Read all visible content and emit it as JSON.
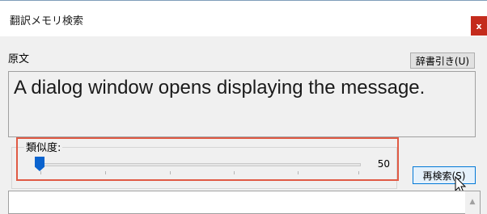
{
  "window": {
    "title": "翻訳メモリ検索",
    "close_label": "x"
  },
  "source": {
    "label": "原文",
    "dictionary_button": "辞書引き(U)",
    "text": "A dialog window opens displaying the message."
  },
  "similarity": {
    "label": "類似度:",
    "value": "50",
    "level_fraction": 0.0
  },
  "research_button": "再検索(S)",
  "icons": {
    "close": "close-icon",
    "cursor": "mouse-pointer-icon",
    "scroll_up": "chevron-up-icon"
  },
  "colors": {
    "highlight_border": "#e05a44",
    "slider_thumb": "#0b63ce",
    "close_button": "#c42b1c"
  }
}
